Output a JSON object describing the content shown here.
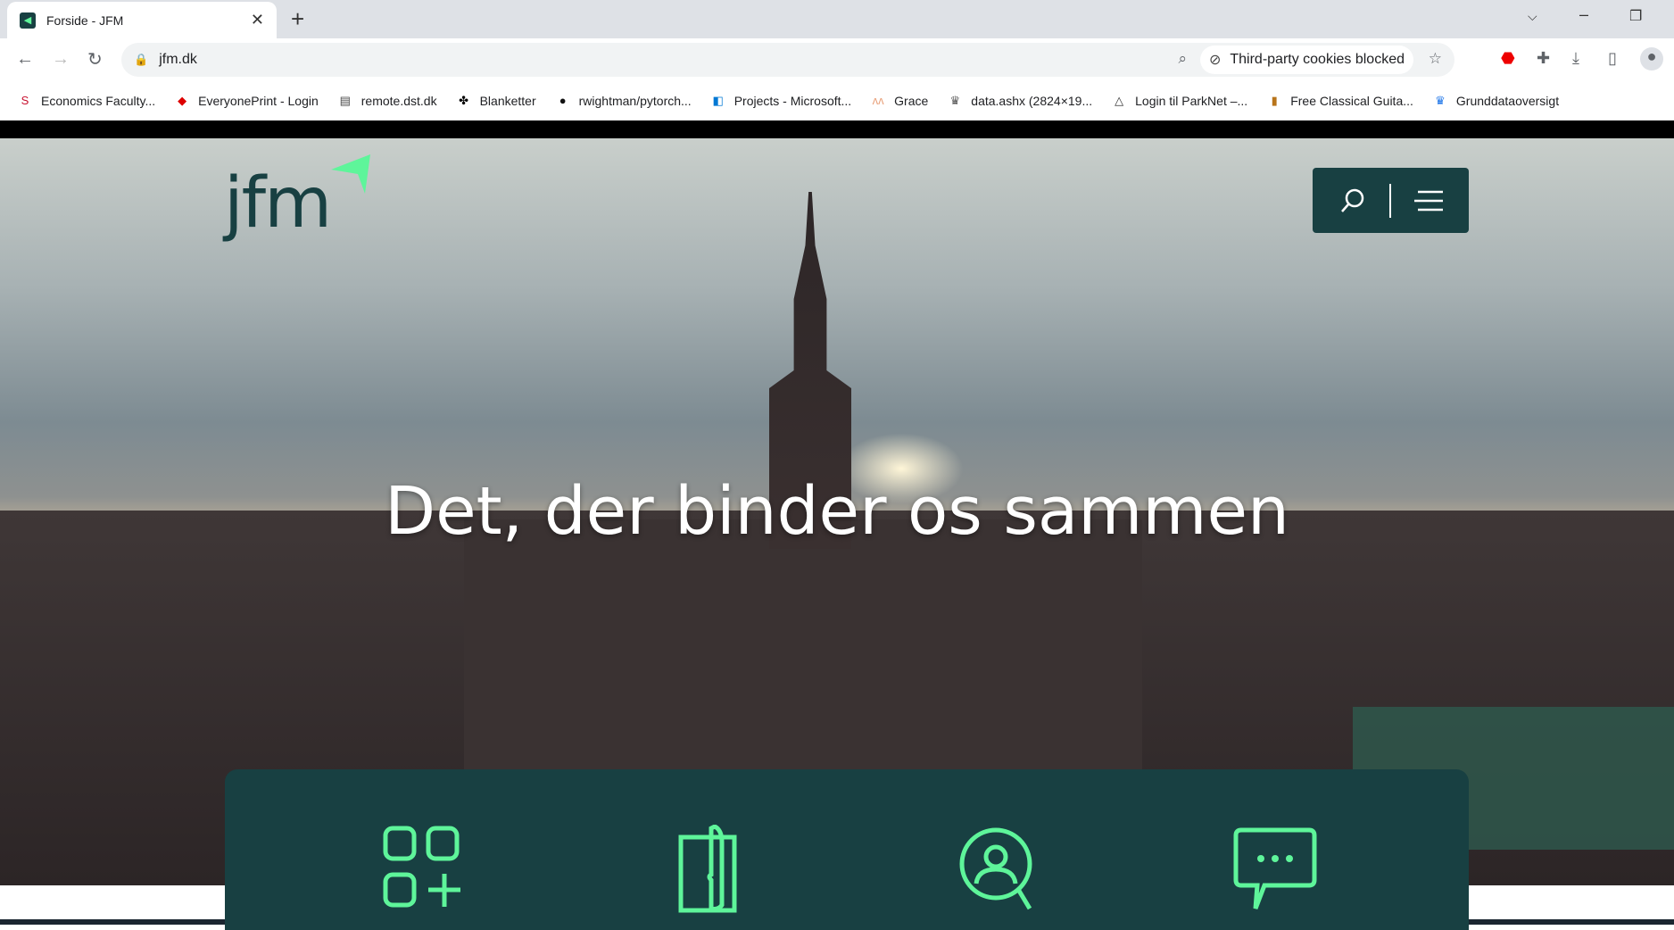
{
  "browser": {
    "tab": {
      "title": "Forside - JFM"
    },
    "url": "jfm.dk",
    "cookies_chip": "Third-party cookies blocked",
    "bookmarks": [
      {
        "label": "Economics Faculty...",
        "icon": "s-icon"
      },
      {
        "label": "EveryonePrint - Login",
        "icon": "everyoneprint-icon"
      },
      {
        "label": "remote.dst.dk",
        "icon": "document-icon"
      },
      {
        "label": "Blanketter",
        "icon": "blanketter-icon"
      },
      {
        "label": "rwightman/pytorch...",
        "icon": "github-icon"
      },
      {
        "label": "Projects - Microsoft...",
        "icon": "azure-devops-icon"
      },
      {
        "label": "Grace",
        "icon": "grace-icon"
      },
      {
        "label": "data.ashx (2824×19...",
        "icon": "crown-icon"
      },
      {
        "label": "Login til ParkNet –...",
        "icon": "parknet-icon"
      },
      {
        "label": "Free Classical Guita...",
        "icon": "guitar-icon"
      },
      {
        "label": "Grunddataoversigt",
        "icon": "crown-icon"
      }
    ]
  },
  "site": {
    "logo": "jfm",
    "headline": "Det, der binder os sammen",
    "quick_links": [
      "apps-icon",
      "document-icon",
      "person-search-icon",
      "chat-icon"
    ],
    "colors": {
      "brand": "#184042",
      "accent": "#5ef59a"
    }
  }
}
